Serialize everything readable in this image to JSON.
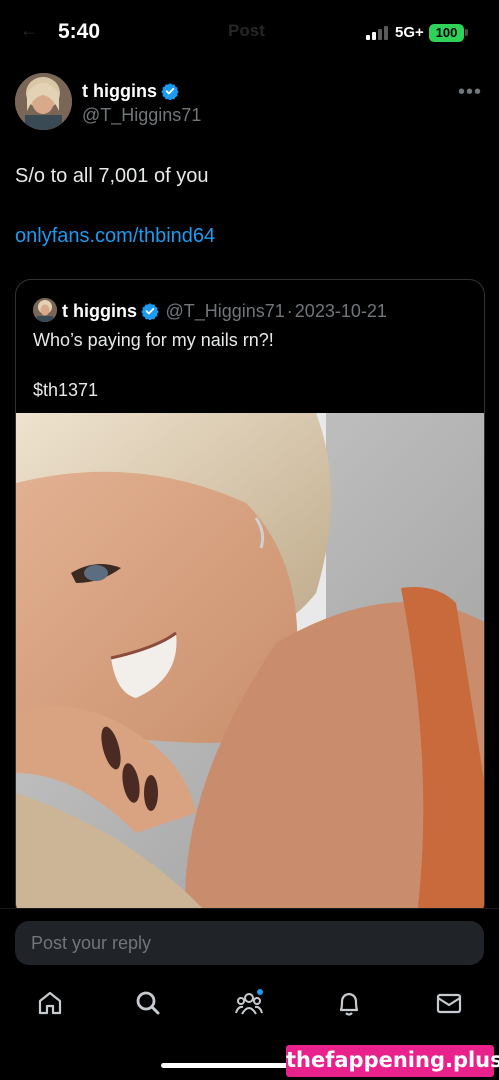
{
  "status_bar": {
    "time": "5:40",
    "network": "5G+",
    "battery": "100"
  },
  "header": {
    "title": "Post"
  },
  "post": {
    "author_name": "t higgins",
    "author_handle": "@T_Higgins71",
    "more_label": "•••",
    "text": "S/o to all 7,001 of you",
    "link": "onlyfans.com/thbind64"
  },
  "quote": {
    "author_name": "t higgins",
    "author_handle": "@T_Higgins71",
    "separator": "·",
    "date": "2023-10-21",
    "text": "Who’s paying for my nails rn?!",
    "tag": "$th1371"
  },
  "reply": {
    "placeholder": "Post your reply"
  },
  "tabs": [
    {
      "name": "home",
      "icon": "home-icon"
    },
    {
      "name": "search",
      "icon": "search-icon"
    },
    {
      "name": "communities",
      "icon": "communities-icon"
    },
    {
      "name": "notifications",
      "icon": "bell-icon"
    },
    {
      "name": "messages",
      "icon": "mail-icon"
    }
  ],
  "watermark": "thefappening.plus",
  "colors": {
    "background": "#000000",
    "link": "#1d9bf0",
    "verified": "#1d9bf0",
    "muted": "#71767b",
    "battery": "#30d158",
    "watermark": "#e8218c"
  }
}
